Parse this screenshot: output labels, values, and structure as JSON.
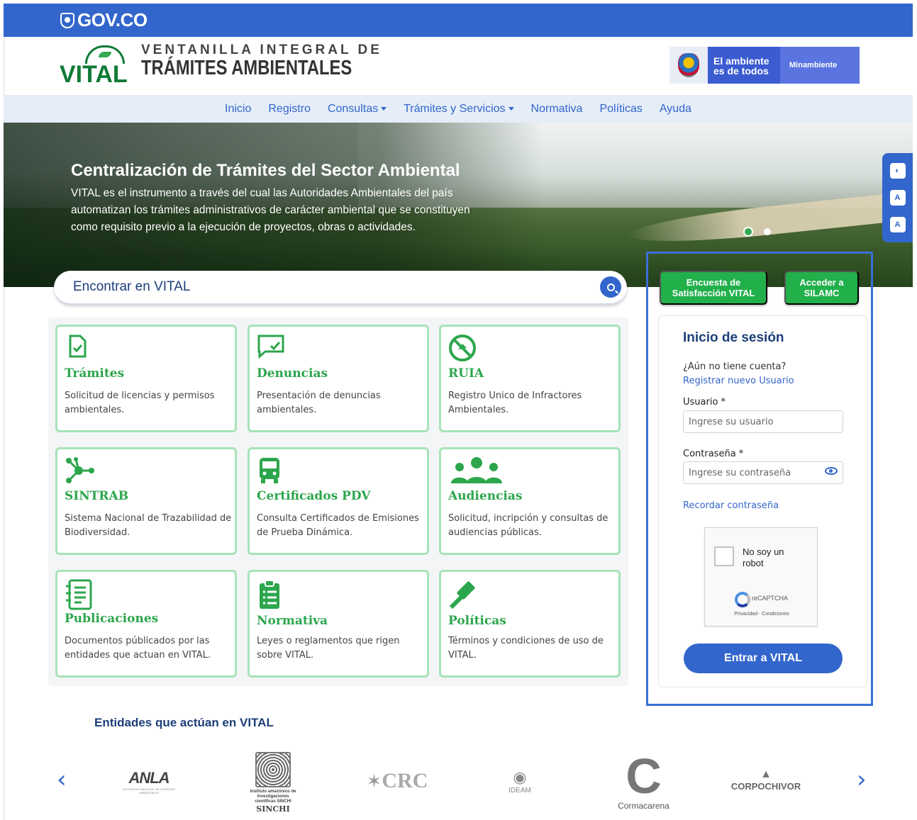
{
  "gov_bar": {
    "logo_text": "GOV.CO"
  },
  "header": {
    "logo_word": "VITAL",
    "title_line1": "VENTANILLA INTEGRAL DE",
    "title_line2": "TRÁMITES AMBIENTALES",
    "ministry_tagline": "El ambiente es de todos",
    "ministry_name": "Minambiente"
  },
  "nav": {
    "items": [
      {
        "label": "Inicio",
        "dropdown": false
      },
      {
        "label": "Registro",
        "dropdown": false
      },
      {
        "label": "Consultas",
        "dropdown": true
      },
      {
        "label": "Trámites y Servicios",
        "dropdown": true
      },
      {
        "label": "Normativa",
        "dropdown": false
      },
      {
        "label": "Políticas",
        "dropdown": false
      },
      {
        "label": "Ayuda",
        "dropdown": false
      }
    ]
  },
  "hero": {
    "title": "Centralización de Trámites del Sector Ambiental",
    "text": "VITAL es el instrumento a través del cual las Autoridades Ambientales del país automatizan los trámites administrativos de carácter ambiental que se constituyen como requisito previo a la ejecución de proyectos, obras o actividades.",
    "slides": 2,
    "active_slide": 1
  },
  "accessibility": {
    "icons": [
      "contrast-icon",
      "font-decrease-icon",
      "font-increase-icon"
    ],
    "labels": [
      "A",
      "A",
      "A"
    ]
  },
  "search": {
    "placeholder": "Encontrar en VITAL"
  },
  "cards": [
    {
      "title": "Trámites",
      "desc": "Solicitud de licencias y permisos ambientales.",
      "icon": "document-check-icon"
    },
    {
      "title": "Denuncias",
      "desc": "Presentación de denuncias ambientales.",
      "icon": "chat-check-icon"
    },
    {
      "title": "RUIA",
      "desc": "Registro Unico de Infractores Ambientales.",
      "icon": "prohibited-icon"
    },
    {
      "title": "SINTRAB",
      "desc": "Sistema Nacional de Trazabilidad de Biodiversidad.",
      "icon": "network-icon"
    },
    {
      "title": "Certificados PDV",
      "desc": "Consulta Certificados de Emisiones de Prueba Dinámica.",
      "icon": "bus-icon"
    },
    {
      "title": "Audiencias",
      "desc": "Solicitud, incripción y consultas de audiencias públicas.",
      "icon": "people-icon"
    },
    {
      "title": "Publicaciones",
      "desc": "Documentos públicados por las entidades que actuan en VITAL.",
      "icon": "notebook-icon"
    },
    {
      "title": "Normativa",
      "desc": "Leyes o reglamentos que rigen sobre VITAL.",
      "icon": "clipboard-list-icon"
    },
    {
      "title": "Políticas",
      "desc": "Términos y condiciones de uso de VITAL.",
      "icon": "gavel-icon"
    }
  ],
  "quick_buttons": {
    "survey": "Encuesta de Satisfacción VITAL",
    "silamc": "Acceder a SILAMC"
  },
  "login": {
    "title": "Inicio de sesión",
    "no_account": "¿Aún no tiene cuenta?",
    "register_link": "Registrar nuevo Usuario",
    "user_label": "Usuario *",
    "user_placeholder": "Ingrese su usuario",
    "password_label": "Contraseña *",
    "password_placeholder": "Ingrese su contraseña",
    "forgot_link": "Recordar contraseña",
    "captcha_text": "No soy un robot",
    "captcha_brand": "reCAPTCHA",
    "captcha_links": "Privacidad - Condiciones",
    "submit": "Entrar a VITAL"
  },
  "entities": {
    "title": "Entidades que actúan en VITAL",
    "logos": [
      {
        "name": "ANLA",
        "sub": "AUTORIDAD NACIONAL DE LICENCIAS AMBIENTALES"
      },
      {
        "name": "Instituto amazónico de investigaciones científicas SINCHI",
        "sub": "SINCHI"
      },
      {
        "name": "CRC",
        "sub": ""
      },
      {
        "name": "IDEAM",
        "sub": ""
      },
      {
        "name": "Cormacarena",
        "sub": ""
      },
      {
        "name": "CORPOCHIVOR",
        "sub": ""
      }
    ]
  },
  "colors": {
    "gov_blue": "#3366cc",
    "green": "#2ca64c",
    "card_border": "#a6e3b8",
    "title_navy": "#1d3f7a"
  }
}
